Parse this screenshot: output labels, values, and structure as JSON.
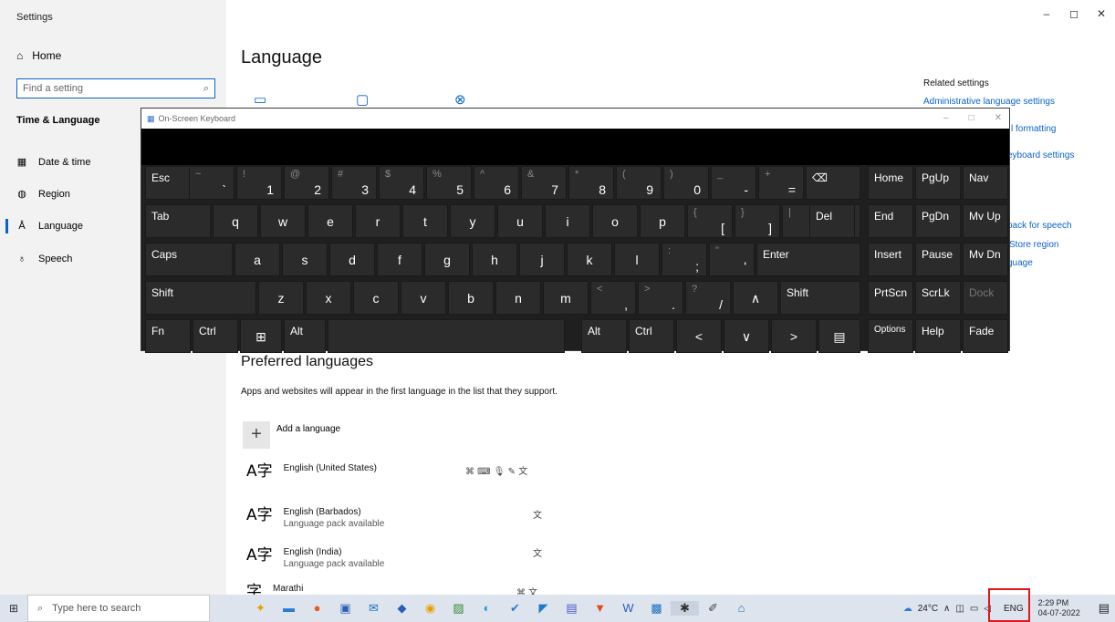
{
  "settings": {
    "window_title": "Settings",
    "home": "Home",
    "search_placeholder": "Find a setting",
    "section": "Time & Language",
    "nav": [
      {
        "label": "Date & time",
        "icon": "calendar-icon"
      },
      {
        "label": "Region",
        "icon": "globe-icon"
      },
      {
        "label": "Language",
        "icon": "language-icon"
      },
      {
        "label": "Speech",
        "icon": "microphone-icon"
      }
    ],
    "active_nav": "Language",
    "page_title": "Language",
    "window_controls": [
      "–",
      "◻",
      "✕"
    ],
    "related": {
      "title": "Related settings",
      "links": [
        "Administrative language settings",
        "l formatting",
        "eyboard settings",
        "pack for speech",
        "Store region",
        "guage"
      ]
    },
    "preferred": {
      "title": "Preferred languages",
      "desc": "Apps and websites will appear in the first language in the list that they support.",
      "add": "Add a language",
      "languages": [
        {
          "name": "English (United States)",
          "sub": "",
          "features": "⌘ ⌨ 🎙 ✎ 文"
        },
        {
          "name": "English (Barbados)",
          "sub": "Language pack available",
          "features": "文"
        },
        {
          "name": "English (India)",
          "sub": "Language pack available",
          "features": "文"
        },
        {
          "name": "Marathi",
          "sub": "",
          "features": "⌘ 文"
        }
      ]
    }
  },
  "osk": {
    "title": "On-Screen Keyboard",
    "controls": [
      "–",
      "□",
      "✕"
    ],
    "rows": [
      [
        {
          "m": "Esc"
        },
        {
          "t": "~",
          "b": "`"
        },
        {
          "t": "!",
          "b": "1"
        },
        {
          "t": "@",
          "b": "2"
        },
        {
          "t": "#",
          "b": "3"
        },
        {
          "t": "$",
          "b": "4"
        },
        {
          "t": "%",
          "b": "5"
        },
        {
          "t": "^",
          "b": "6"
        },
        {
          "t": "&",
          "b": "7"
        },
        {
          "t": "*",
          "b": "8"
        },
        {
          "t": "(",
          "b": "9"
        },
        {
          "t": ")",
          "b": "0"
        },
        {
          "t": "_",
          "b": "-"
        },
        {
          "t": "+",
          "b": "="
        },
        {
          "m": "⌫"
        }
      ],
      [
        {
          "m": "Tab"
        },
        {
          "c": "q"
        },
        {
          "c": "w"
        },
        {
          "c": "e"
        },
        {
          "c": "r"
        },
        {
          "c": "t"
        },
        {
          "c": "y"
        },
        {
          "c": "u"
        },
        {
          "c": "i"
        },
        {
          "c": "o"
        },
        {
          "c": "p"
        },
        {
          "t": "{",
          "b": "["
        },
        {
          "t": "}",
          "b": "]"
        },
        {
          "t": "|",
          "b": "\\"
        },
        {
          "m": "Del"
        }
      ],
      [
        {
          "m": "Caps"
        },
        {
          "c": "a"
        },
        {
          "c": "s"
        },
        {
          "c": "d"
        },
        {
          "c": "f"
        },
        {
          "c": "g"
        },
        {
          "c": "h"
        },
        {
          "c": "j"
        },
        {
          "c": "k"
        },
        {
          "c": "l"
        },
        {
          "t": ":",
          "b": ";"
        },
        {
          "t": "\"",
          "b": "'"
        },
        {
          "m": "Enter"
        }
      ],
      [
        {
          "m": "Shift"
        },
        {
          "c": "z"
        },
        {
          "c": "x"
        },
        {
          "c": "c"
        },
        {
          "c": "v"
        },
        {
          "c": "b"
        },
        {
          "c": "n"
        },
        {
          "c": "m"
        },
        {
          "t": "<",
          "b": ","
        },
        {
          "t": ">",
          "b": "."
        },
        {
          "t": "?",
          "b": "/"
        },
        {
          "c": "∧"
        },
        {
          "m": "Shift"
        }
      ],
      [
        {
          "m": "Fn"
        },
        {
          "m": "Ctrl"
        },
        {
          "c": "⊞"
        },
        {
          "m": "Alt"
        },
        {
          "m": ""
        },
        {
          "m": "Alt"
        },
        {
          "m": "Ctrl"
        },
        {
          "c": "<"
        },
        {
          "c": "∨"
        },
        {
          "c": ">"
        },
        {
          "c": "▤"
        }
      ]
    ],
    "side": [
      [
        "Home",
        "PgUp",
        "Nav"
      ],
      [
        "End",
        "PgDn",
        "Mv Up"
      ],
      [
        "Insert",
        "Pause",
        "Mv Dn"
      ],
      [
        "PrtScn",
        "ScrLk",
        "Dock"
      ],
      [
        "Options",
        "Help",
        "Fade"
      ]
    ]
  },
  "taskbar": {
    "search": "Type here to search",
    "weather": "24°C",
    "lang": "ENG",
    "time": "2:29 PM",
    "date": "04-07-2022"
  }
}
